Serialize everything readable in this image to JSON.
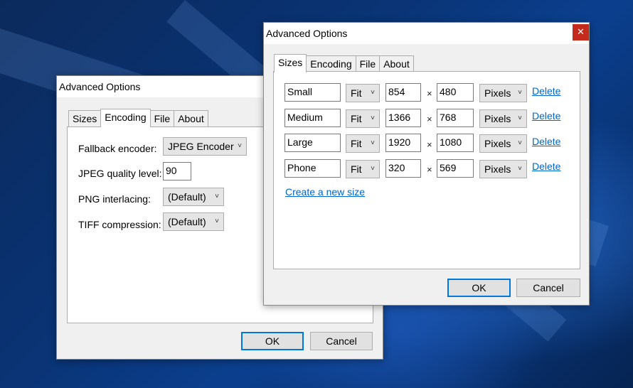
{
  "encoding_dialog": {
    "title": "Advanced Options",
    "tabs": [
      {
        "label": "Sizes"
      },
      {
        "label": "Encoding"
      },
      {
        "label": "File"
      },
      {
        "label": "About"
      }
    ],
    "fallback_encoder_label": "Fallback encoder:",
    "fallback_encoder_value": "JPEG Encoder",
    "jpeg_quality_label": "JPEG quality level:",
    "jpeg_quality_value": "90",
    "png_interlacing_label": "PNG interlacing:",
    "png_interlacing_value": "(Default)",
    "tiff_compression_label": "TIFF compression:",
    "tiff_compression_value": "(Default)",
    "ok_label": "OK",
    "cancel_label": "Cancel"
  },
  "sizes_dialog": {
    "title": "Advanced Options",
    "close_glyph": "✕",
    "tabs": [
      {
        "label": "Sizes"
      },
      {
        "label": "Encoding"
      },
      {
        "label": "File"
      },
      {
        "label": "About"
      }
    ],
    "times_glyph": "×",
    "chevron_glyph": "˅",
    "rows": [
      {
        "name": "Small",
        "mode": "Fit",
        "width": "854",
        "height": "480",
        "unit": "Pixels",
        "delete": "Delete"
      },
      {
        "name": "Medium",
        "mode": "Fit",
        "width": "1366",
        "height": "768",
        "unit": "Pixels",
        "delete": "Delete"
      },
      {
        "name": "Large",
        "mode": "Fit",
        "width": "1920",
        "height": "1080",
        "unit": "Pixels",
        "delete": "Delete"
      },
      {
        "name": "Phone",
        "mode": "Fit",
        "width": "320",
        "height": "569",
        "unit": "Pixels",
        "delete": "Delete"
      }
    ],
    "create_link": "Create a new size",
    "ok_label": "OK",
    "cancel_label": "Cancel"
  }
}
